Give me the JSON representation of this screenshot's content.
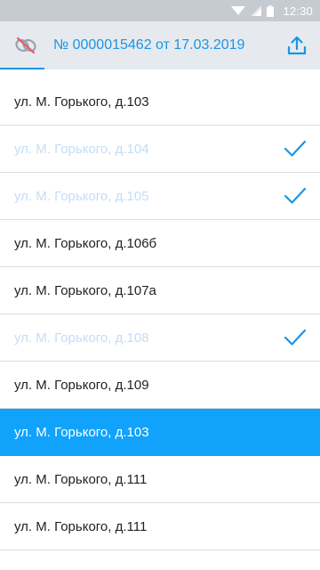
{
  "status_bar": {
    "time": "12:30"
  },
  "app_bar": {
    "title": "№ 0000015462 от 17.03.2019"
  },
  "addresses": [
    {
      "label": "ул. М. Горького, д.103",
      "done": false,
      "selected": false
    },
    {
      "label": "ул. М. Горького, д.104",
      "done": true,
      "selected": false
    },
    {
      "label": "ул. М. Горького, д.105",
      "done": true,
      "selected": false
    },
    {
      "label": "ул. М. Горького, д.106б",
      "done": false,
      "selected": false
    },
    {
      "label": "ул. М. Горького, д.107а",
      "done": false,
      "selected": false
    },
    {
      "label": "ул. М. Горького, д.108",
      "done": true,
      "selected": false
    },
    {
      "label": "ул. М. Горького, д.109",
      "done": false,
      "selected": false
    },
    {
      "label": "ул. М. Горького, д.103",
      "done": false,
      "selected": true
    },
    {
      "label": "ул. М. Горького, д.111",
      "done": false,
      "selected": false
    },
    {
      "label": "ул. М. Горького, д.111",
      "done": false,
      "selected": false
    }
  ],
  "colors": {
    "accent": "#1996e6",
    "selected_row": "#11a2fb",
    "done_text": "#c6dcf4"
  },
  "icons": {
    "app_icon": "chain-link-icon",
    "upload": "upload-icon",
    "check": "check-icon"
  }
}
